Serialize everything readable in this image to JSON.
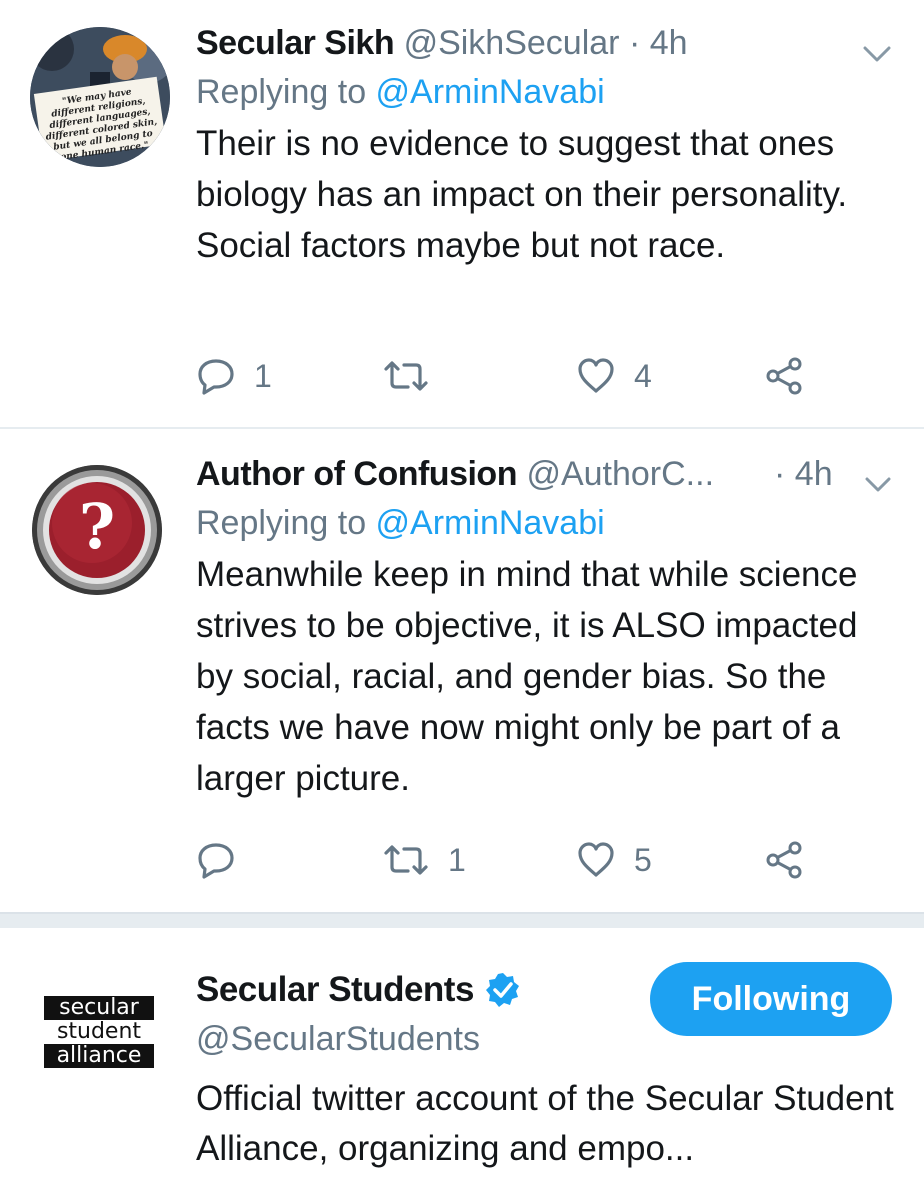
{
  "tweets": [
    {
      "name": "Secular Sikh",
      "handle": "@SikhSecular",
      "dot": "·",
      "time": "4h",
      "replying_prefix": "Replying to ",
      "replying_to": "@ArminNavabi",
      "body": "Their is no evidence to suggest that ones biology has an impact on their personality. Social factors maybe but not race.",
      "avatar_sign_text": "\"We may have different religions, different languages, different colored skin, but we all belong to one human race.\"",
      "replies": "1",
      "retweets": "",
      "likes": "4"
    },
    {
      "name": "Author of Confusion",
      "handle": "@AuthorC...",
      "dot": "·",
      "time": "4h",
      "replying_prefix": "Replying to ",
      "replying_to": "@ArminNavabi",
      "body": "Meanwhile keep in mind that while science strives to be objective, it is ALSO impacted by social, racial, and gender bias. So the facts we have now might only be part of a larger picture.",
      "avatar_glyph": "?",
      "replies": "",
      "retweets": "1",
      "likes": "5"
    }
  ],
  "account": {
    "name": "Secular Students",
    "handle": "@SecularStudents",
    "verified": true,
    "follow_label": "Following",
    "bio": "Official twitter account of the Secular Student Alliance, organizing and empo...",
    "logo_lines": [
      "secular",
      "student",
      "alliance"
    ]
  },
  "colors": {
    "accent": "#1da1f2",
    "muted": "#657786",
    "text": "#14171a",
    "divider": "#e6ecf0"
  },
  "icons": [
    "chevron-down-icon",
    "reply-icon",
    "retweet-icon",
    "like-icon",
    "share-icon",
    "verified-badge-icon"
  ]
}
